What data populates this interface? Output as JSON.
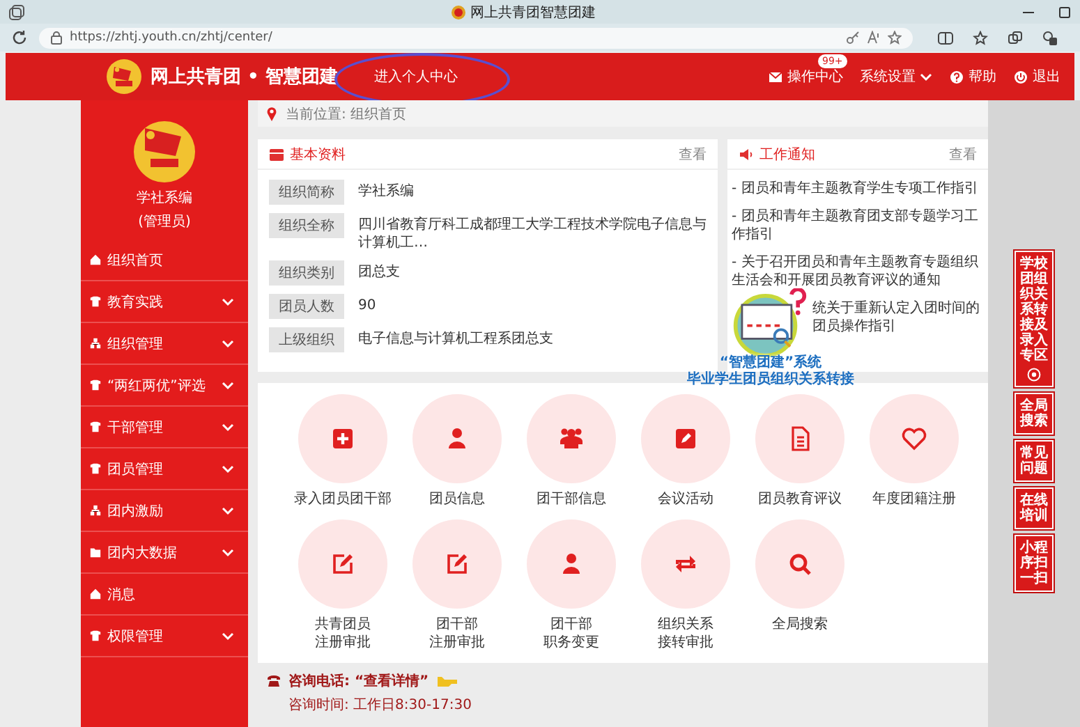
{
  "browser": {
    "tab_title": "网上共青团智慧团建",
    "url": "https://zhtj.youth.cn/zhtj/center/"
  },
  "header": {
    "site_title": "网上共青团 • 智慧团建",
    "personal_center_link": "进入个人中心",
    "actions": [
      {
        "kind": "mail",
        "label": "操作中心",
        "badge": "99+"
      },
      {
        "kind": "settings",
        "label": "系统设置"
      },
      {
        "kind": "help",
        "label": "帮助"
      },
      {
        "kind": "logout",
        "label": "退出"
      }
    ]
  },
  "sidebar": {
    "org_name": "学社系编",
    "role": "(管理员)",
    "items": [
      {
        "label": "组织首页",
        "expandable": false
      },
      {
        "label": "教育实践",
        "expandable": true
      },
      {
        "label": "组织管理",
        "expandable": true
      },
      {
        "label": "“两红两优”评选",
        "expandable": true
      },
      {
        "label": "干部管理",
        "expandable": true
      },
      {
        "label": "团员管理",
        "expandable": true
      },
      {
        "label": "团内激励",
        "expandable": true
      },
      {
        "label": "团内大数据",
        "expandable": true
      },
      {
        "label": "消息",
        "expandable": false
      },
      {
        "label": "权限管理",
        "expandable": true
      }
    ]
  },
  "breadcrumb": "当前位置: 组织首页",
  "basic_info": {
    "title": "基本资料",
    "more": "查看",
    "rows": [
      {
        "label": "组织简称",
        "value": "学社系编"
      },
      {
        "label": "组织全称",
        "value": "四川省教育厅科工成都理工大学工程技术学院电子信息与计算机工…"
      },
      {
        "label": "组织类别",
        "value": "团总支"
      },
      {
        "label": "团员人数",
        "value": "90"
      },
      {
        "label": "上级组织",
        "value": "电子信息与计算机工程系团总支"
      }
    ]
  },
  "notices": {
    "title": "工作通知",
    "more": "查看",
    "items": [
      "- 团员和青年主题教育学生专项工作指引",
      "- 团员和青年主题教育团支部专题学习工作指引",
      "- 关于召开团员和青年主题教育专题组织生活会和开展团员教育评议的通知",
      "统关于重新认定入团时间的团员操作指引"
    ]
  },
  "promo": {
    "title": "“智慧团建”系统",
    "subtitle": "毕业学生团员组织关系转接"
  },
  "shortcuts": [
    {
      "lines": [
        "录入团员团干部"
      ]
    },
    {
      "lines": [
        "团员信息"
      ]
    },
    {
      "lines": [
        "团干部信息"
      ]
    },
    {
      "lines": [
        "会议活动"
      ]
    },
    {
      "lines": [
        "团员教育评议"
      ]
    },
    {
      "lines": [
        "年度团籍注册"
      ]
    },
    {
      "lines": [
        "共青团员",
        "注册审批"
      ]
    },
    {
      "lines": [
        "团干部",
        "注册审批"
      ]
    },
    {
      "lines": [
        "团干部",
        "职务变更"
      ]
    },
    {
      "lines": [
        "组织关系",
        "接转审批"
      ]
    },
    {
      "lines": [
        "全局搜索"
      ]
    }
  ],
  "side_buttons": [
    {
      "kind": "zone",
      "label": "学校团组织关系转接及录入专区"
    },
    {
      "kind": "plain",
      "label": "全局搜索"
    },
    {
      "kind": "plain",
      "label": "常见问题"
    },
    {
      "kind": "plain",
      "label": "在线培训"
    },
    {
      "kind": "plain",
      "label": "小程序扫一扫"
    }
  ],
  "footer": {
    "hotline": "咨询电话: “查看详情”",
    "hours": "咨询时间: 工作日8:30-17:30"
  }
}
